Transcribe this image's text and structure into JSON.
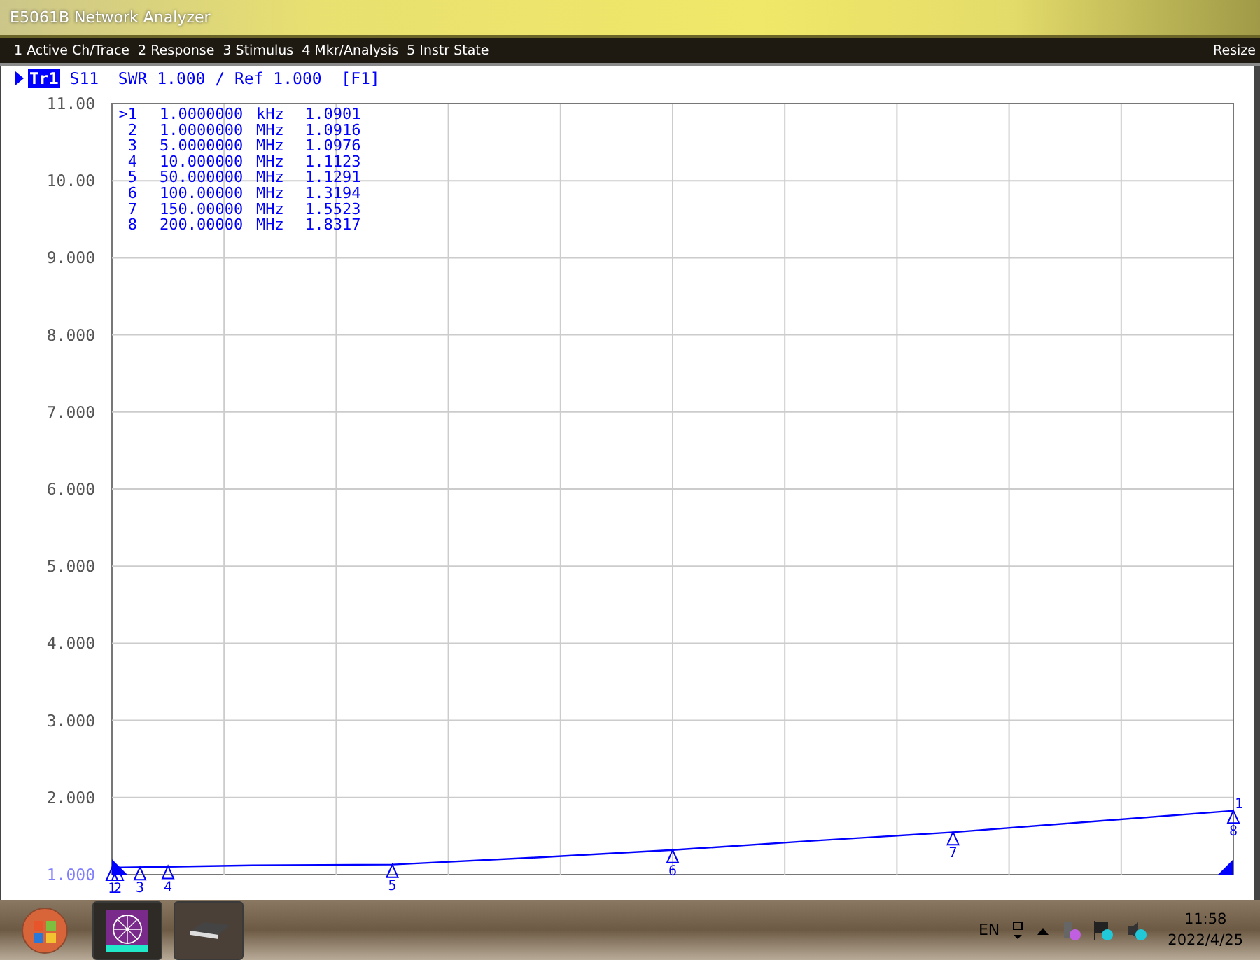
{
  "window": {
    "title": "E5061B Network Analyzer"
  },
  "menu": {
    "items": [
      {
        "label": "1 Active Ch/Trace"
      },
      {
        "label": "2 Response"
      },
      {
        "label": "3 Stimulus"
      },
      {
        "label": "4 Mkr/Analysis"
      },
      {
        "label": "5 Instr State"
      }
    ],
    "resize": "Resize"
  },
  "trace_header": {
    "trace": "Tr1",
    "selected": true,
    "text": "S11  SWR 1.000 / Ref 1.000  [F1]"
  },
  "markers": [
    {
      "number": ">1",
      "frequency": "1.0000000",
      "unit": "kHz",
      "value": "1.0901",
      "chart_label": "1"
    },
    {
      "number": "2",
      "frequency": "1.0000000",
      "unit": "MHz",
      "value": "1.0916",
      "chart_label": "2"
    },
    {
      "number": "3",
      "frequency": "5.0000000",
      "unit": "MHz",
      "value": "1.0976",
      "chart_label": "3"
    },
    {
      "number": "4",
      "frequency": "10.000000",
      "unit": "MHz",
      "value": "1.1123",
      "chart_label": "4"
    },
    {
      "number": "5",
      "frequency": "50.000000",
      "unit": "MHz",
      "value": "1.1291",
      "chart_label": "5"
    },
    {
      "number": "6",
      "frequency": "100.00000",
      "unit": "MHz",
      "value": "1.3194",
      "chart_label": "6"
    },
    {
      "number": "7",
      "frequency": "150.00000",
      "unit": "MHz",
      "value": "1.5523",
      "chart_label": "7"
    },
    {
      "number": "8",
      "frequency": "200.00000",
      "unit": "MHz",
      "value": "1.8317",
      "chart_label": "8"
    }
  ],
  "chart_data": {
    "type": "line",
    "categories": [
      null,
      null,
      null,
      null,
      null,
      null,
      null,
      null,
      null
    ],
    "series": [
      {
        "color": "#0000ff",
        "values": [
          1.09,
          1.12,
          1.13,
          1.22,
          1.32,
          1.44,
          1.55,
          1.69,
          1.83
        ]
      }
    ],
    "ylim": [
      1,
      11
    ],
    "grid": true,
    "yticks": [
      {
        "value": 11,
        "label": "11.00"
      },
      {
        "value": 10,
        "label": "10.00"
      },
      {
        "value": 9,
        "label": "9.000"
      },
      {
        "value": 8,
        "label": "8.000"
      },
      {
        "value": 7,
        "label": "7.000"
      },
      {
        "value": 6,
        "label": "6.000"
      },
      {
        "value": 5,
        "label": "5.000"
      },
      {
        "value": 4,
        "label": "4.000"
      },
      {
        "value": 3,
        "label": "3.000"
      },
      {
        "value": 2,
        "label": "2.000"
      },
      {
        "value": 1,
        "label": "1.000"
      }
    ],
    "annotations": [
      {
        "text": "1"
      }
    ]
  },
  "taskbar": {
    "apps": [
      {
        "kind": "analyzer",
        "selected": true
      },
      {
        "kind": "device",
        "selected": false
      }
    ],
    "language": "EN",
    "time": "11:58",
    "date": "2022/4/25"
  }
}
